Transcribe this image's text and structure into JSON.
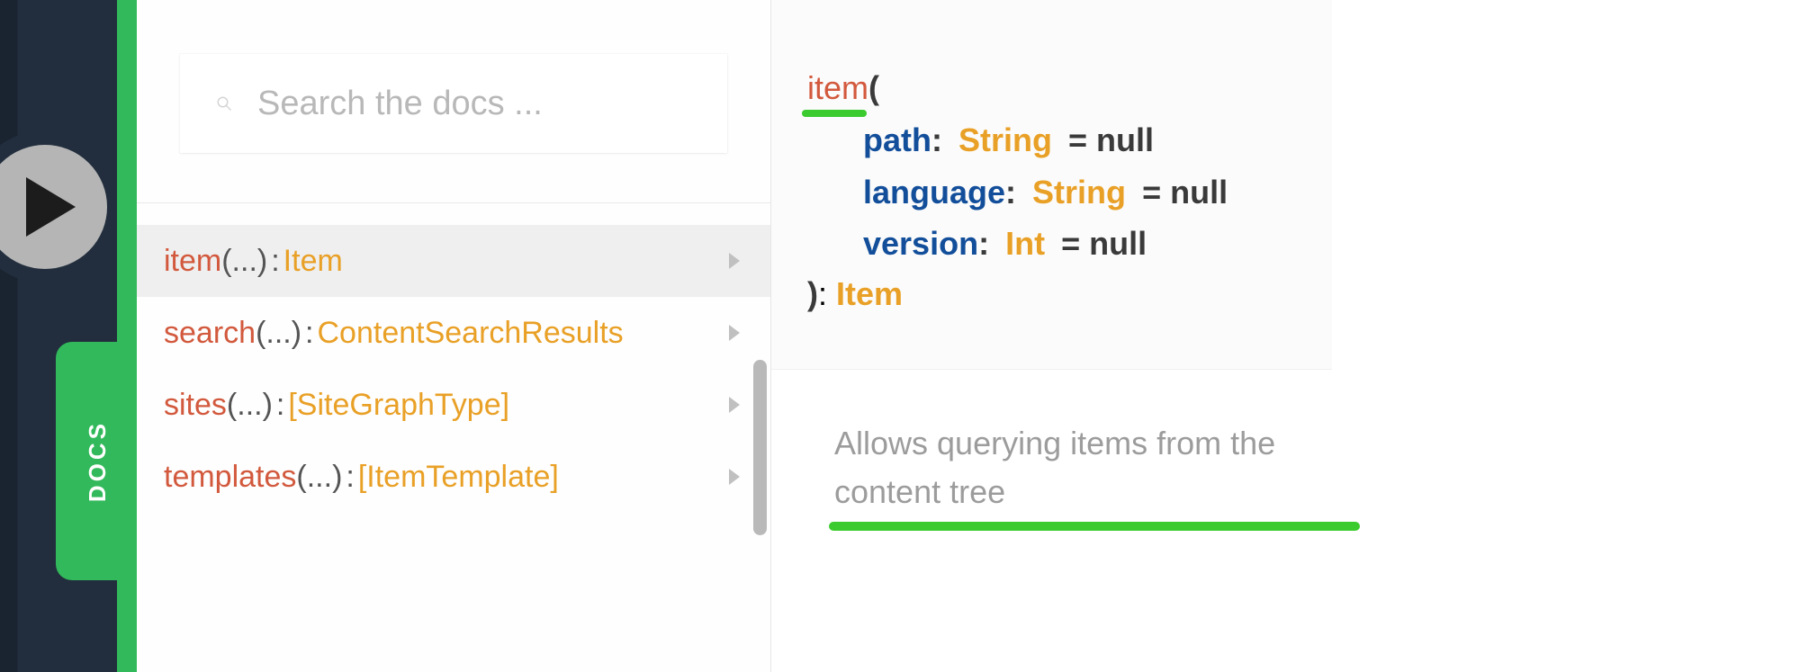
{
  "app": {
    "docs_tab_label": "DOCS"
  },
  "search": {
    "placeholder": "Search the docs ..."
  },
  "fields": [
    {
      "name": "item",
      "args": "(...)",
      "type": "Item",
      "active": true
    },
    {
      "name": "search",
      "args": "(...)",
      "type": "ContentSearchResults",
      "active": false
    },
    {
      "name": "sites",
      "args": "(...)",
      "type": "[SiteGraphType]",
      "active": false
    },
    {
      "name": "templates",
      "args": "(...)",
      "type": "[ItemTemplate]",
      "active": false
    }
  ],
  "detail": {
    "name": "item",
    "open_paren": "(",
    "close_paren": ")",
    "args": [
      {
        "name": "path",
        "type": "String",
        "default": "= null"
      },
      {
        "name": "language",
        "type": "String",
        "default": "= null"
      },
      {
        "name": "version",
        "type": "Int",
        "default": "= null"
      }
    ],
    "return_type": "Item",
    "description": "Allows querying items from the content tree"
  },
  "punct": {
    "colon": ":",
    "colon_space": ": "
  }
}
